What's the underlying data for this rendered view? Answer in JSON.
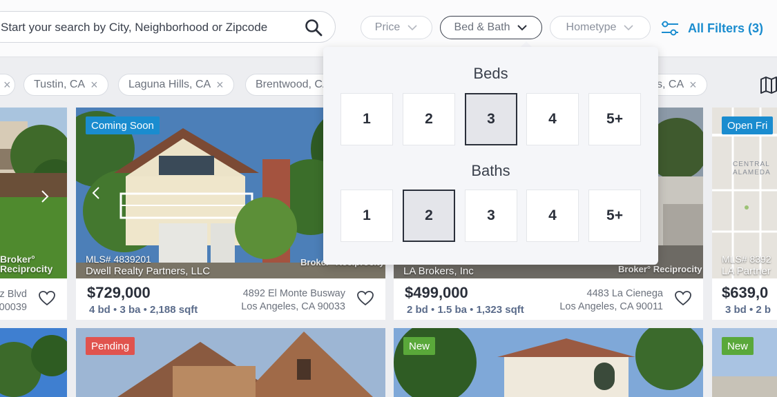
{
  "search": {
    "placeholder": "Start your search by City, Neighborhood or Zipcode"
  },
  "filters": {
    "price_label": "Price",
    "bed_bath_label": "Bed & Bath",
    "hometype_label": "Hometype",
    "all_filters_label": "All Filters (3)"
  },
  "chips": [
    {
      "label": "Tustin, CA"
    },
    {
      "label": "Laguna Hills, CA"
    },
    {
      "label": "Brentwood, CA"
    },
    {
      "label": "s, CA"
    }
  ],
  "dropdown": {
    "beds_title": "Beds",
    "baths_title": "Baths",
    "beds_options": [
      "1",
      "2",
      "3",
      "4",
      "5+"
    ],
    "baths_options": [
      "1",
      "2",
      "3",
      "4",
      "5+"
    ],
    "beds_selected": "3",
    "baths_selected": "2"
  },
  "cards": [
    {
      "street": "z Blvd",
      "city": "00039",
      "watermark": "Broker°\nReciprocity"
    },
    {
      "badge": "Coming Soon",
      "mls": "MLS# 4839201",
      "brokerage": "Dwell Realty Partners, LLC",
      "price": "$729,000",
      "bd": "4 bd",
      "ba": "3 ba",
      "sqft": "2,188 sqft",
      "street": "4892 El Monte Busway",
      "city": "Los Angeles, CA 90033",
      "watermark": "Broker° Reciprocity"
    },
    {
      "brokerage": "LA Brokers, Inc",
      "price": "$499,000",
      "bd": "2 bd",
      "ba": "1.5 ba",
      "sqft": "1,323 sqft",
      "street": "4483 La Cienega",
      "city": "Los Angeles, CA 90011",
      "watermark": "Broker° Reciprocity"
    },
    {
      "badge": "Open Fri",
      "mls": "MLS# 8392",
      "brokerage": "LA Partner",
      "price": "$639,0",
      "specs": "3 bd • 2 b",
      "map_label_1": "CENTRAL",
      "map_label_2": "ALAMEDA"
    }
  ],
  "row2": [
    {
      "badge": "Pending"
    },
    {
      "badge": "New"
    },
    {
      "badge": "New"
    }
  ],
  "colors": {
    "accent": "#1a8ccf",
    "coming_soon": "#1a8ccf",
    "pending": "#e0534e",
    "new": "#5aa83a",
    "open": "#1a8ccf"
  }
}
